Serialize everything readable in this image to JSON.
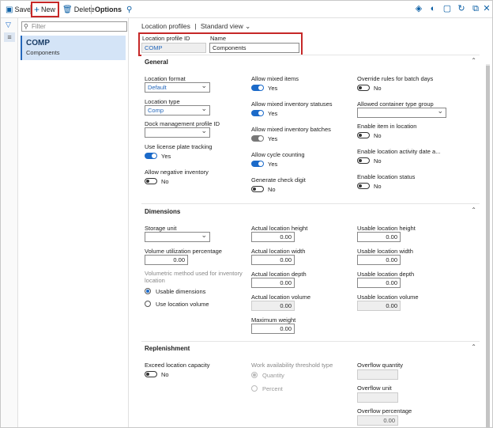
{
  "toolbar": {
    "save": "Save",
    "new": "New",
    "delete": "Delete",
    "options": "Options"
  },
  "list": {
    "filter_placeholder": "Filter",
    "selected_id": "COMP",
    "selected_name": "Components"
  },
  "breadcrumb": {
    "view": "Location profiles",
    "separator": "|",
    "mode": "Standard view"
  },
  "header": {
    "id_label": "Location profile ID",
    "id_value": "COMP",
    "name_label": "Name",
    "name_value": "Components"
  },
  "general": {
    "title": "General",
    "location_format_label": "Location format",
    "location_format_value": "Default",
    "location_type_label": "Location type",
    "location_type_value": "Comp",
    "dock_label": "Dock management profile ID",
    "dock_value": "",
    "license_label": "Use license plate tracking",
    "license_value": "Yes",
    "neg_inv_label": "Allow negative inventory",
    "neg_inv_value": "No",
    "mixed_items_label": "Allow mixed items",
    "mixed_items_value": "Yes",
    "mixed_status_label": "Allow mixed inventory statuses",
    "mixed_status_value": "Yes",
    "mixed_batches_label": "Allow mixed inventory batches",
    "mixed_batches_value": "Yes",
    "cycle_label": "Allow cycle counting",
    "cycle_value": "Yes",
    "check_digit_label": "Generate check digit",
    "check_digit_value": "No",
    "override_label": "Override rules for batch days",
    "override_value": "No",
    "container_label": "Allowed container type group",
    "container_value": "",
    "enable_item_label": "Enable item in location",
    "enable_item_value": "No",
    "activity_label": "Enable location activity date a...",
    "activity_value": "No",
    "status_label": "Enable location status",
    "status_value": "No"
  },
  "dimensions": {
    "title": "Dimensions",
    "storage_unit_label": "Storage unit",
    "storage_unit_value": "",
    "vol_util_label": "Volume utilization percentage",
    "vol_util_value": "0.00",
    "volumetric_label_1": "Volumetric method used for inventory",
    "volumetric_label_2": "location",
    "opt_usable": "Usable dimensions",
    "opt_location": "Use location volume",
    "actual_height_label": "Actual location height",
    "actual_height_value": "0.00",
    "actual_width_label": "Actual location width",
    "actual_width_value": "0.00",
    "actual_depth_label": "Actual location depth",
    "actual_depth_value": "0.00",
    "actual_volume_label": "Actual location volume",
    "actual_volume_value": "0.00",
    "max_weight_label": "Maximum weight",
    "max_weight_value": "0.00",
    "usable_height_label": "Usable location height",
    "usable_height_value": "0.00",
    "usable_width_label": "Usable location width",
    "usable_width_value": "0.00",
    "usable_depth_label": "Usable location depth",
    "usable_depth_value": "0.00",
    "usable_volume_label": "Usable location volume",
    "usable_volume_value": "0.00"
  },
  "replenishment": {
    "title": "Replenishment",
    "exceed_label": "Exceed location capacity",
    "exceed_value": "No",
    "threshold_label": "Work availability threshold type",
    "opt_quantity": "Quantity",
    "opt_percent": "Percent",
    "overflow_qty_label": "Overflow quantity",
    "overflow_qty_value": "",
    "overflow_unit_label": "Overflow unit",
    "overflow_unit_value": "",
    "overflow_pct_label": "Overflow percentage",
    "overflow_pct_value": "0.00"
  },
  "colors": {
    "accent": "#1b6ac9",
    "highlight": "#c62828",
    "selected_bg": "#d4e4f7"
  }
}
